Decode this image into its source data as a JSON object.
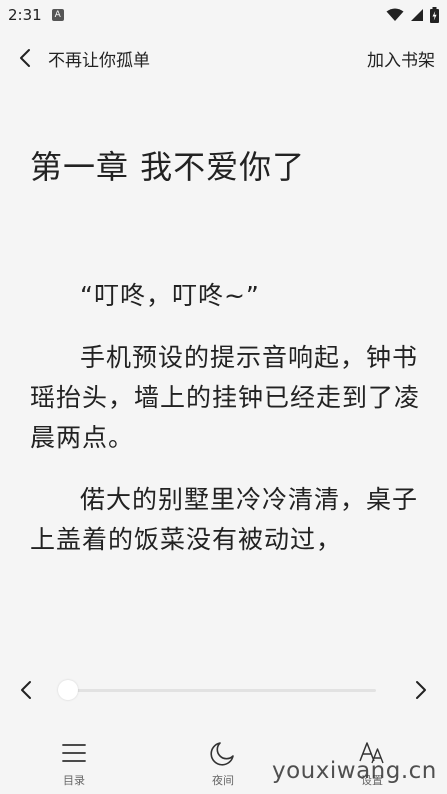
{
  "status_bar": {
    "time": "2:31",
    "badge": "A",
    "icons": [
      "wifi-icon",
      "signal-icon",
      "battery-icon"
    ]
  },
  "header": {
    "back_icon": "chevron-left-icon",
    "book_title": "不再让你孤单",
    "add_to_shelf": "加入书架"
  },
  "chapter": {
    "title": "第一章 我不爱你了",
    "paragraphs": [
      "“叮咚，叮咚~”",
      "手机预设的提示音响起，钟书瑶抬头，墙上的挂钟已经走到了凌晨两点。",
      "偌大的别墅里冷冷清清，桌子上盖着的饭菜没有被动过，"
    ]
  },
  "progress": {
    "value": 0.0,
    "prev_icon": "chevron-left-icon",
    "next_icon": "chevron-right-icon"
  },
  "bottom_nav": {
    "items": [
      {
        "label": "目录",
        "icon": "menu-icon"
      },
      {
        "label": "夜间",
        "icon": "moon-icon"
      },
      {
        "label": "设置",
        "icon": "font-size-icon"
      }
    ]
  },
  "watermark": "youxiwang.cn"
}
